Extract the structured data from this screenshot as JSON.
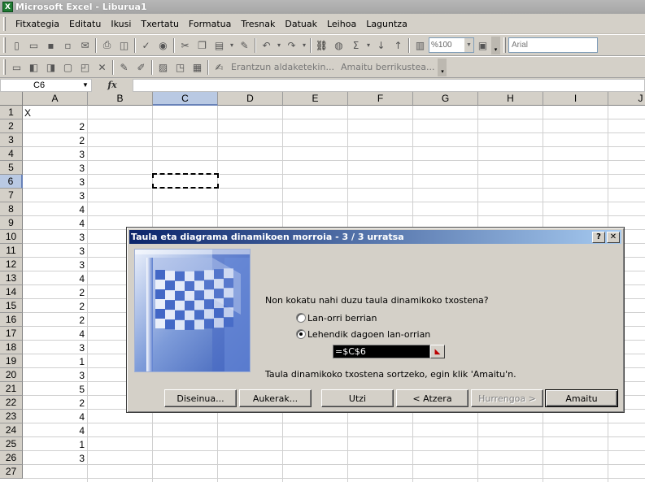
{
  "window": {
    "title": "Microsoft Excel - Liburua1",
    "app_icon_letter": "X"
  },
  "menu": {
    "items": [
      "Fitxategia",
      "Editatu",
      "Ikusi",
      "Txertatu",
      "Formatua",
      "Tresnak",
      "Datuak",
      "Leihoa",
      "Laguntza"
    ]
  },
  "toolbar": {
    "zoom": "%100",
    "font": "Arial",
    "review_track": "Erantzun aldaketekin...",
    "review_end": "Amaitu berrikustea..."
  },
  "formula_bar": {
    "name_box": "C6",
    "fx_label": "fx",
    "formula": ""
  },
  "grid": {
    "columns": [
      "A",
      "B",
      "C",
      "D",
      "E",
      "F",
      "G",
      "H",
      "I",
      "J"
    ],
    "rows": [
      "1",
      "2",
      "3",
      "4",
      "5",
      "6",
      "7",
      "8",
      "9",
      "10",
      "11",
      "12",
      "13",
      "14",
      "15",
      "16",
      "17",
      "18",
      "19",
      "20",
      "21",
      "22",
      "23",
      "24",
      "25",
      "26",
      "27"
    ],
    "selected_column": "C",
    "selected_row": "6",
    "column_a": [
      "X",
      "2",
      "2",
      "3",
      "3",
      "3",
      "3",
      "4",
      "4",
      "3",
      "3",
      "3",
      "4",
      "2",
      "2",
      "2",
      "4",
      "3",
      "1",
      "3",
      "5",
      "2",
      "4",
      "4",
      "1",
      "3",
      ""
    ]
  },
  "dialog": {
    "title": "Taula eta diagrama dinamikoen morroia - 3 / 3 urratsa",
    "help_button": "?",
    "close_button": "✕",
    "question": "Non kokatu nahi duzu taula dinamikoko txostena?",
    "option_new_sheet": "Lan-orri berrian",
    "option_existing_sheet": "Lehendik dagoen lan-orrian",
    "reference": "=$C$6",
    "finish_hint": "Taula dinamikoko txostena sortzeko, egin klik 'Amaitu'n.",
    "buttons": {
      "layout": "Diseinua...",
      "options": "Aukerak...",
      "cancel": "Utzi",
      "back": "< Atzera",
      "next": "Hurrengoa >",
      "finish": "Amaitu"
    }
  }
}
